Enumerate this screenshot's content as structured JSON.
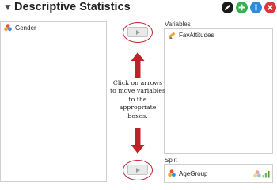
{
  "header": {
    "title": "Descriptive Statistics",
    "buttons": [
      "edit-icon",
      "add-icon",
      "info-icon",
      "close-icon"
    ],
    "colors": {
      "edit": "#1a1a1a",
      "add": "#2fb34a",
      "info": "#2e8bdb",
      "close": "#d9373a"
    }
  },
  "source_list": {
    "items": [
      {
        "label": "Gender",
        "icon": "nominal-variable-icon"
      }
    ]
  },
  "variables": {
    "label": "Variables",
    "items": [
      {
        "label": "FavAttitudes",
        "icon": "scale-variable-icon"
      }
    ]
  },
  "split": {
    "label": "Split",
    "items": [
      {
        "label": "AgeGroup",
        "icon": "nominal-variable-icon"
      }
    ]
  },
  "annotation": {
    "text": "Click on arrows to move variables to the appropriate boxes.",
    "color": "#c0202a"
  }
}
